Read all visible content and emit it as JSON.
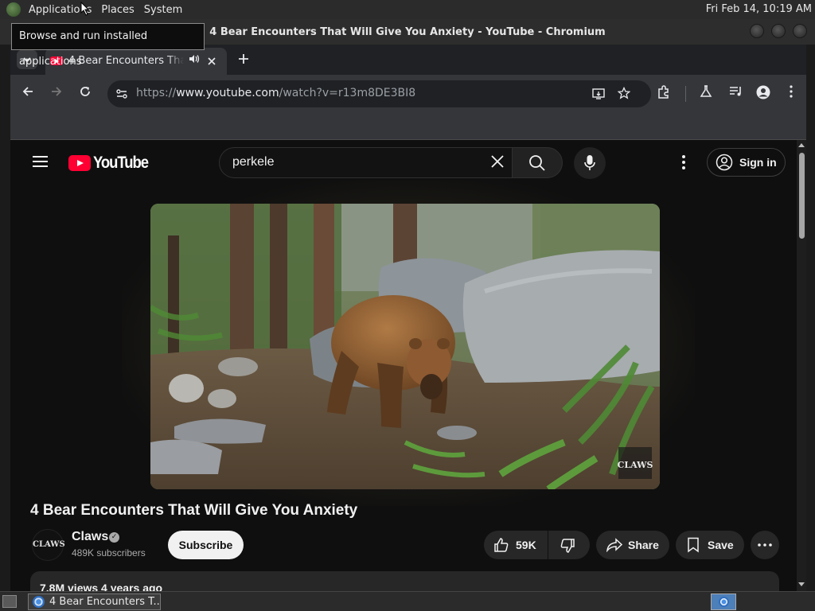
{
  "top_panel": {
    "applications": "Applications",
    "places": "Places",
    "system": "System",
    "clock": "Fri Feb 14, 10:19 AM"
  },
  "tooltip": "Browse and run installed applications",
  "window": {
    "title": "4 Bear Encounters That Will Give You Anxiety - YouTube - Chromium"
  },
  "tab": {
    "title": "4 Bear Encounters That Will Give You Anxiety"
  },
  "toolbar": {
    "url_scheme": "https://",
    "url_host": "www.youtube.com",
    "url_path": "/watch?v=r13m8DE3BI8"
  },
  "youtube": {
    "logo_text": "YouTube",
    "search_value": "perkele",
    "sign_in": "Sign in",
    "video_title": "4 Bear Encounters That Will Give You Anxiety",
    "watermark": "CLAWS",
    "channel_avatar": "CLAWS",
    "channel_name": "Claws",
    "subscribers": "489K subscribers",
    "subscribe": "Subscribe",
    "likes": "59K",
    "share": "Share",
    "save": "Save",
    "description_meta": "7.8M views  4 years ago"
  },
  "taskbar": {
    "task_label": "4 Bear Encounters T..."
  },
  "colors": {
    "yt_red": "#ff0033",
    "page_bg": "#0f0f0f",
    "chrome_toolbar": "#35363a"
  }
}
